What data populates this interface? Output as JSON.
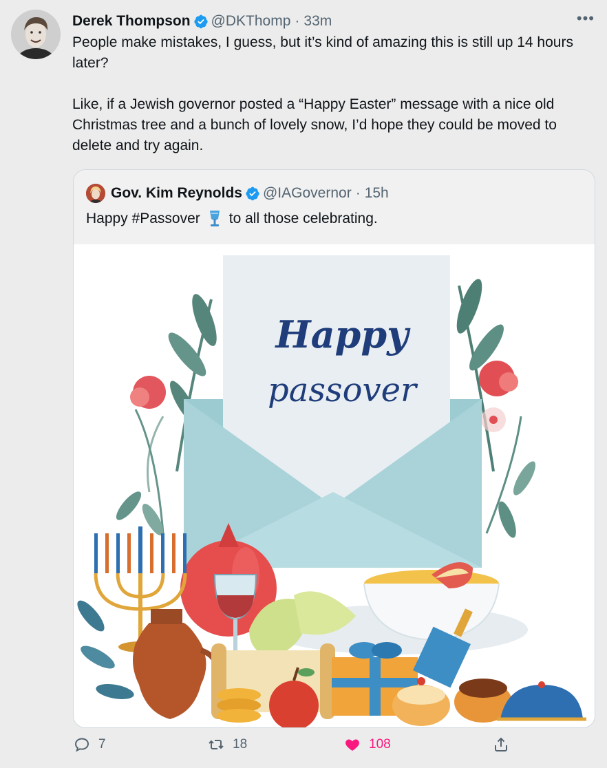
{
  "tweet": {
    "author_name": "Derek Thompson",
    "author_handle": "@DKThomp",
    "time": "33m",
    "dot": "·",
    "paragraphs": [
      "People make mistakes, I guess, but it’s kind of amazing this is still up 14 hours later?",
      "Like, if a Jewish governor posted a “Happy Easter” message with a nice old Christmas tree and a bunch of lovely snow, I’d hope they could be moved to delete and try again."
    ],
    "more_icon": "more-icon"
  },
  "quote": {
    "author_name": "Gov. Kim Reynolds",
    "author_handle": "@IAGovernor",
    "time": "15h",
    "dot": "·",
    "text_before": "Happy #Passover",
    "text_after": "to all those celebrating.",
    "emoji_icon": "kiddush-cup-emoji",
    "image": {
      "title_line1": "Happy",
      "title_line2": "passover"
    }
  },
  "actions": {
    "replies": "7",
    "retweets": "18",
    "likes": "108"
  },
  "colors": {
    "verified": "#1d9bf0",
    "like": "#f91880",
    "muted": "#536471",
    "envelope": "#9ccbd2",
    "card": "#e8eef2",
    "title": "#1f3d7a"
  }
}
